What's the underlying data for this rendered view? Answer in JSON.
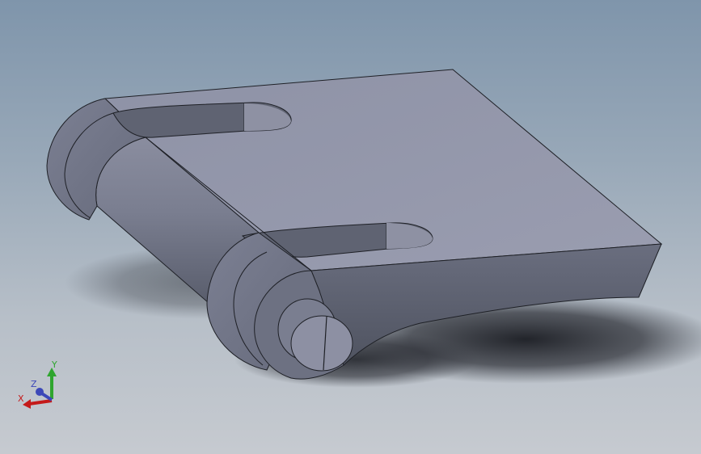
{
  "viewport": {
    "background_top": "#7f95ab",
    "background_bottom": "#c6cad0"
  },
  "model": {
    "part": "hinge-leaf-with-pin",
    "face_light": "#9497ab",
    "face_mid": "#767a8c",
    "face_dark": "#5b5f6e",
    "edge": "#1e2026"
  },
  "triad": {
    "x_label": "X",
    "y_label": "Y",
    "z_label": "Z",
    "x_color": "#c41a1a",
    "y_color": "#2fa52f",
    "z_color": "#3c48b8"
  }
}
